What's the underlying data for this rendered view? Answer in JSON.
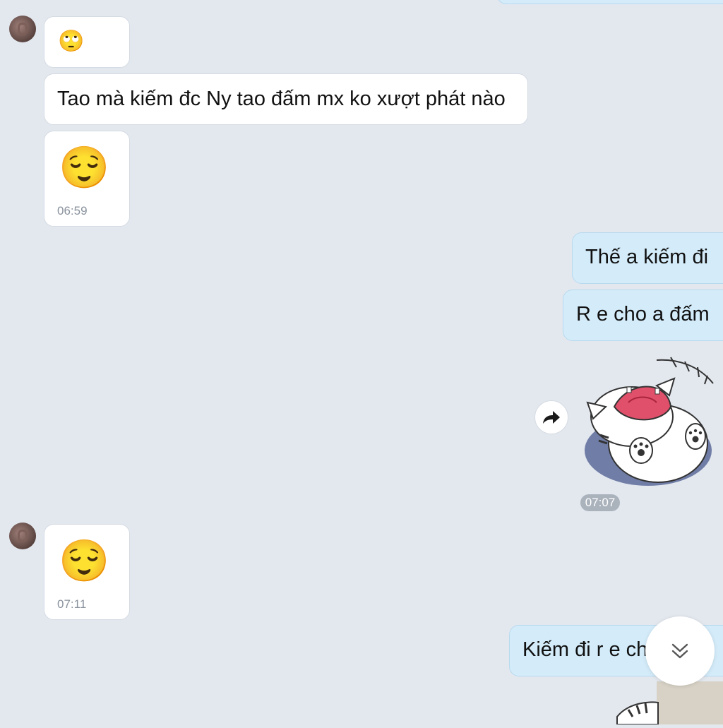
{
  "messages": {
    "m1": {
      "emoji": "🙄"
    },
    "m2": {
      "text": "Tao mà kiếm đc Ny tao đấm mx ko xượt phát nào"
    },
    "m3": {
      "emoji": "😌",
      "time": "06:59"
    },
    "m4": {
      "text": "Thế a kiếm đi"
    },
    "m5": {
      "text": "R e cho a đấm"
    },
    "m6": {
      "sticker": "cat-sticker",
      "time": "07:07"
    },
    "m7": {
      "emoji": "😌",
      "time": "07:11"
    },
    "m8": {
      "text": "Kiếm đi r e cho"
    }
  },
  "icons": {
    "forward": "forward-arrow-icon",
    "scroll": "double-chevron-down-icon"
  },
  "colors": {
    "background": "#e3e8ef",
    "incoming_bubble": "#ffffff",
    "outgoing_bubble": "#d4ecfa"
  }
}
